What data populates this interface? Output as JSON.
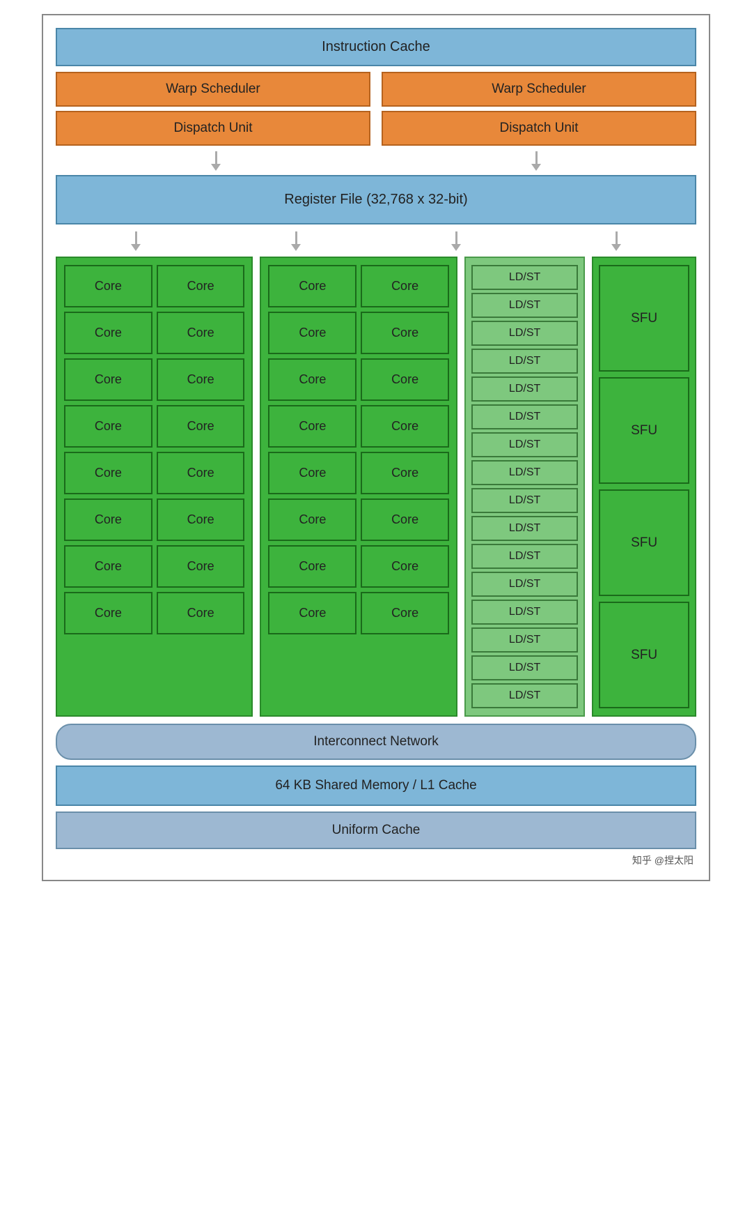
{
  "diagram": {
    "instruction_cache": "Instruction Cache",
    "warp_scheduler_left": "Warp Scheduler",
    "warp_scheduler_right": "Warp Scheduler",
    "dispatch_unit_left": "Dispatch Unit",
    "dispatch_unit_right": "Dispatch Unit",
    "register_file": "Register File (32,768 x 32-bit)",
    "core_label": "Core",
    "ldst_label": "LD/ST",
    "sfu_label": "SFU",
    "interconnect": "Interconnect Network",
    "shared_memory": "64 KB Shared Memory / L1 Cache",
    "uniform_cache": "Uniform Cache",
    "watermark": "知乎 @捏太阳",
    "cores_per_group": 16,
    "ldst_count": 16,
    "sfu_count": 4
  }
}
